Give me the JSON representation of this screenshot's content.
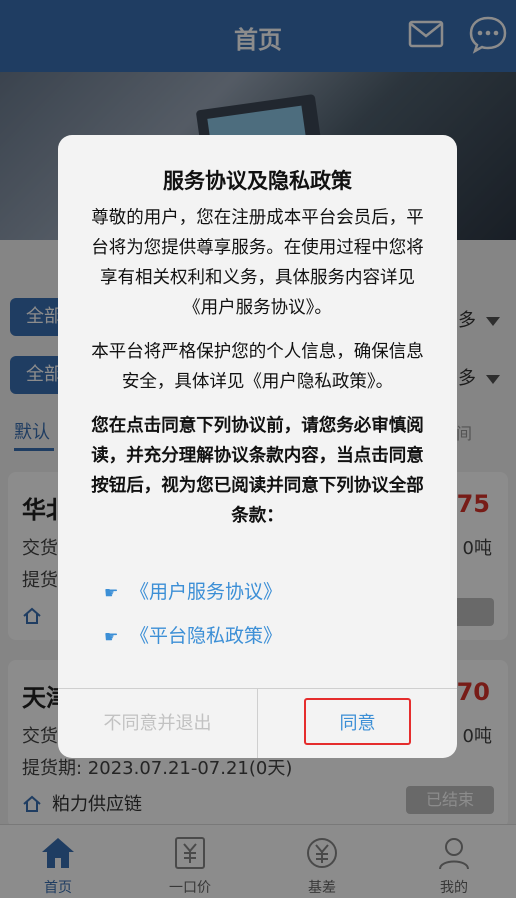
{
  "header": {
    "title": "首页",
    "mail_icon": "mail-icon",
    "chat_icon": "chat-icon"
  },
  "filters": {
    "pill_1": "全部",
    "pill_2": "全部",
    "more_1": "多",
    "more_2": "多",
    "sort_default": "默认",
    "sort_right": "间"
  },
  "cards": [
    {
      "name": "华北",
      "price": "775",
      "line1": "交货",
      "line2": "提货",
      "qty": "0吨",
      "company": "",
      "status": "束"
    },
    {
      "name": "天津",
      "price": "970",
      "line1": "交货",
      "line2": "提货期: 2023.07.21-07.21(0天)",
      "qty": "0吨",
      "company": "粕力供应链",
      "status": "已结束"
    }
  ],
  "tabbar": [
    {
      "label": "首页",
      "icon": "home-icon",
      "active": true
    },
    {
      "label": "一口价",
      "icon": "yuan-ticket-icon"
    },
    {
      "label": "基差",
      "icon": "yuan-cycle-icon"
    },
    {
      "label": "我的",
      "icon": "user-icon"
    }
  ],
  "dialog": {
    "title": "服务协议及隐私政策",
    "para1": "尊敬的用户，您在注册成本平台会员后，平台将为您提供尊享服务。在使用过程中您将享有相关权利和义务，具体服务内容详见《用户服务协议》。",
    "para2": "本平台将严格保护您的个人信息，确保信息安全，具体详见《用户隐私政策》。",
    "warning": "您在点击同意下列协议前，请您务必审慎阅读，并充分理解协议条款内容，当点击同意按钮后，视为您已阅读并同意下列协议全部条款：",
    "link_service": "《用户服务协议》",
    "link_privacy": "《平台隐私政策》",
    "disagree": "不同意并退出",
    "agree": "同意"
  },
  "colors": {
    "primary": "#3a6fb2",
    "link": "#3c8fd6",
    "price": "#d9342b",
    "highlight": "#e52d2d"
  }
}
